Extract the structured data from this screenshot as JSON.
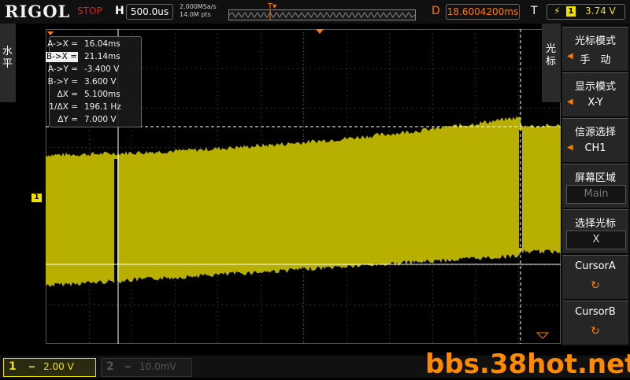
{
  "header": {
    "brand": "RIGOL",
    "run_state": "STOP",
    "timebase_label": "H",
    "timebase_value": "500.0us",
    "sample_rate": "2.000MSa/s",
    "memory_depth": "14.0M pts",
    "delay_label": "D",
    "delay_value": "18.6004200ms",
    "trigger_label": "T",
    "trigger_source": "1",
    "trigger_level": "3.74 V"
  },
  "left_tab": {
    "label": "水平"
  },
  "readout": {
    "rows": [
      {
        "label": "A->X =",
        "value": "16.04ms",
        "highlight": false
      },
      {
        "label": "B->X =",
        "value": "21.14ms",
        "highlight": true
      },
      {
        "label": "A->Y =",
        "value": "-3.400 V",
        "highlight": false
      },
      {
        "label": "B->Y =",
        "value": "3.600 V",
        "highlight": false
      },
      {
        "label": "ΔX =",
        "value": "5.100ms",
        "highlight": false
      },
      {
        "label": "1/ΔX =",
        "value": "196.1 Hz",
        "highlight": false
      },
      {
        "label": "ΔY =",
        "value": "7.000 V",
        "highlight": false
      }
    ]
  },
  "channel_marker": "1",
  "menu": {
    "tab_label": "光标",
    "items": [
      {
        "title": "光标模式",
        "value": "手　动"
      },
      {
        "title": "显示模式",
        "value": "X-Y"
      },
      {
        "title": "信源选择",
        "value": "CH1"
      },
      {
        "title": "屏幕区域",
        "value": "Main"
      },
      {
        "title": "选择光标",
        "value": "X"
      },
      {
        "title": "CursorA",
        "icon": "↻"
      },
      {
        "title": "CursorB",
        "icon": "↻"
      }
    ]
  },
  "footer": {
    "ch1_number": "1",
    "ch1_coupling": "═",
    "ch1_scale": "2.00 V",
    "ch2_number": "2",
    "ch2_coupling": "═",
    "ch2_scale": "10.0mV"
  },
  "watermark": "bbs.38hot.net",
  "colors": {
    "ch1": "#b8b000",
    "trigger": "#ff7d00",
    "stop": "#e02020",
    "watermark": "#ff8a00"
  }
}
